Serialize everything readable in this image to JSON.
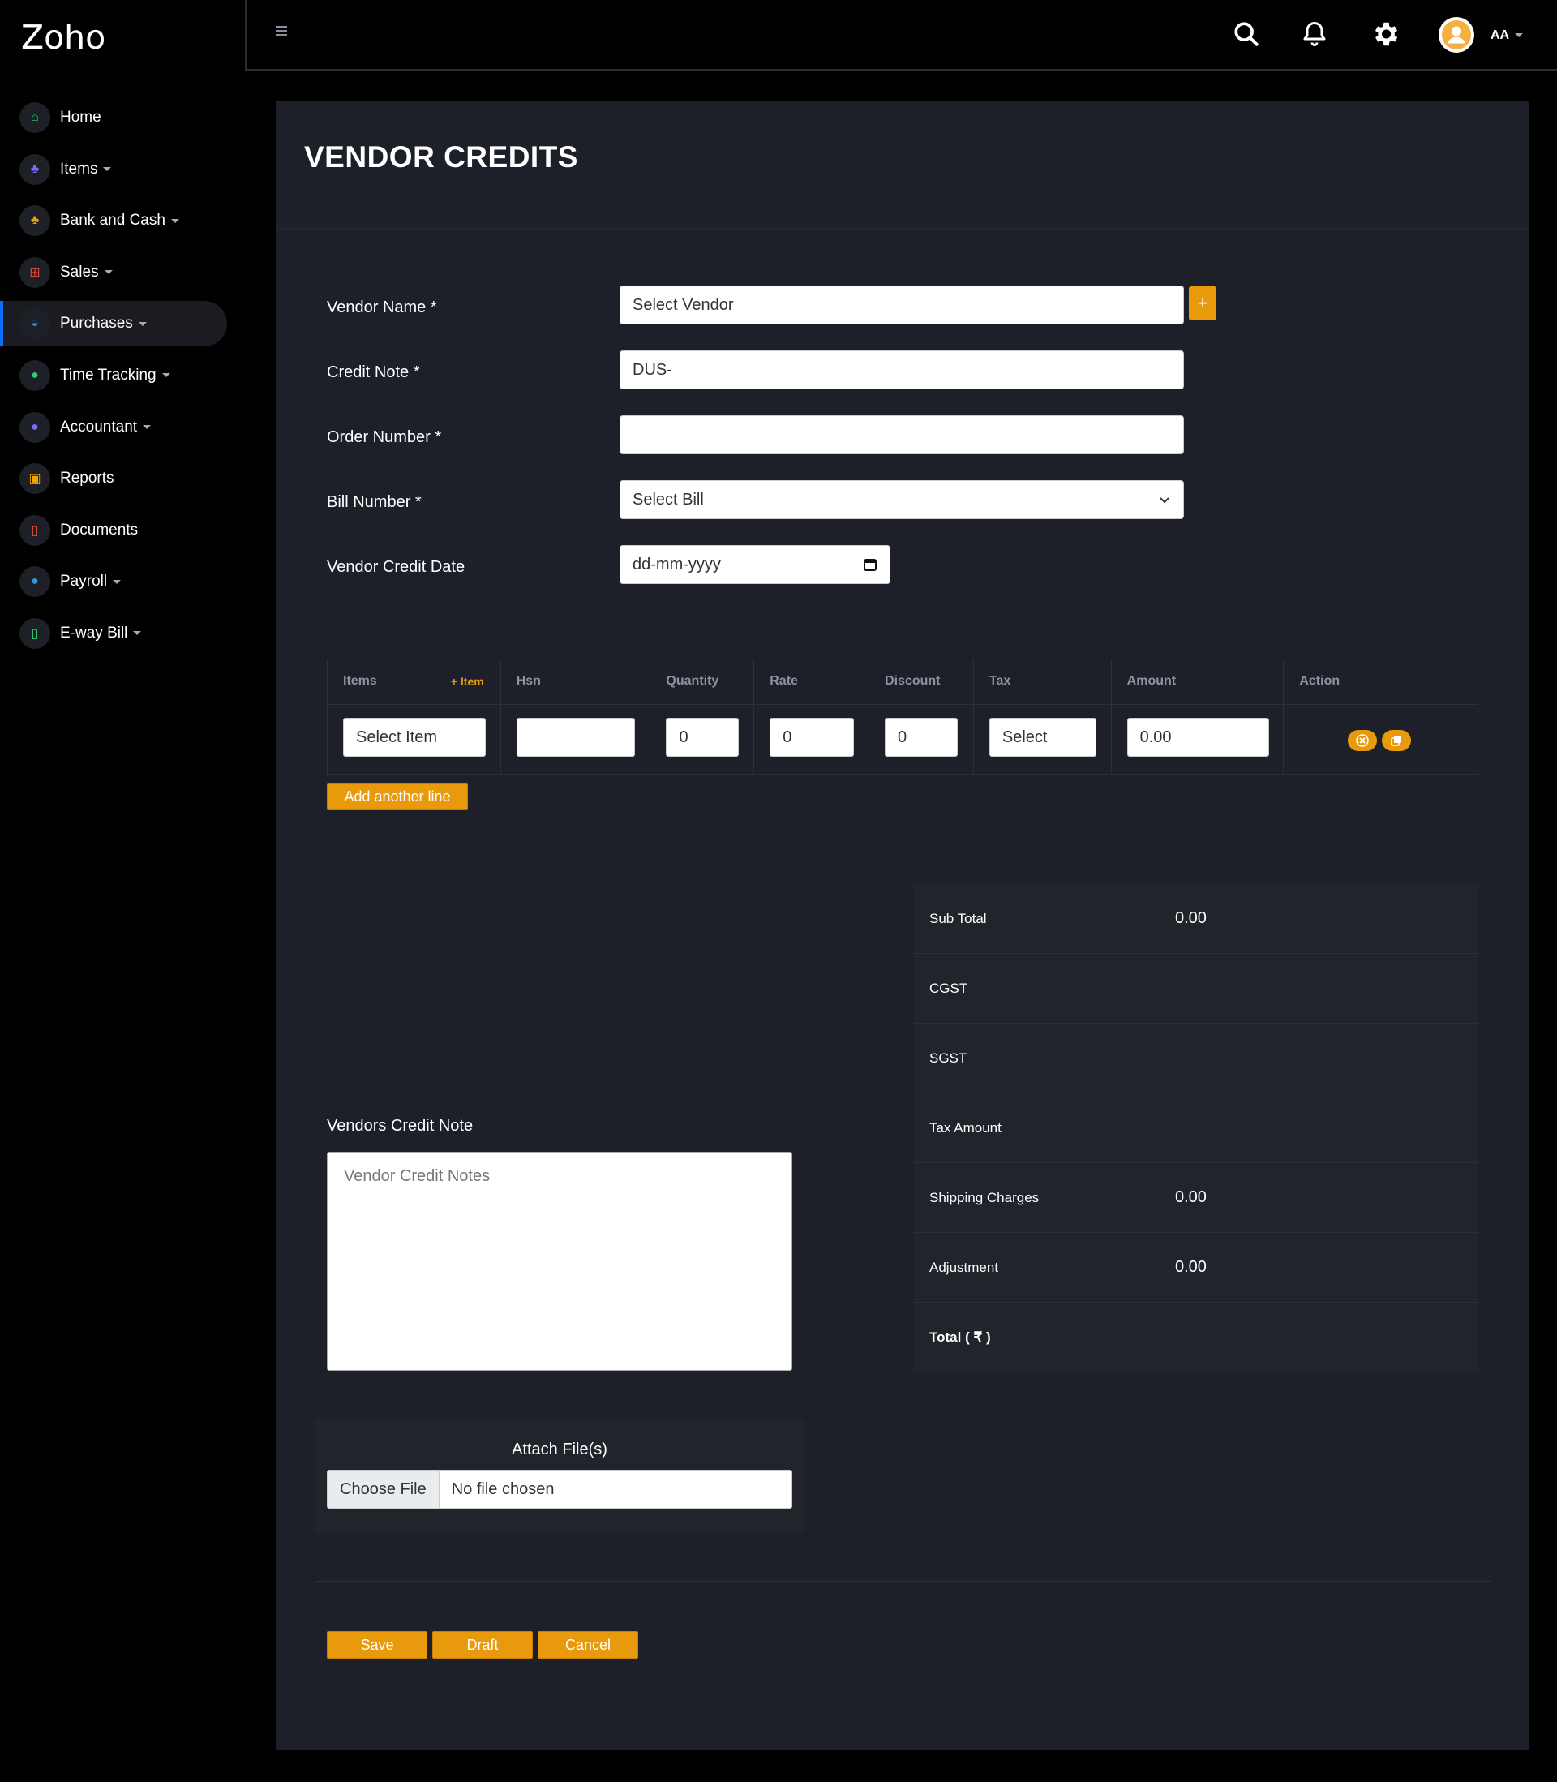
{
  "app": {
    "brand": "Zoho"
  },
  "sidebar": {
    "items": [
      {
        "label": "Home",
        "icon": "home-icon",
        "glyph": "⌂",
        "color": "#2ecc71",
        "caret": false
      },
      {
        "label": "Items",
        "icon": "sitemap-icon",
        "glyph": "♣",
        "color": "#7b6cf6",
        "caret": true
      },
      {
        "label": "Bank and Cash",
        "icon": "sitemap-icon",
        "glyph": "♣",
        "color": "#f0a500",
        "caret": true
      },
      {
        "label": "Sales",
        "icon": "cart-icon",
        "glyph": "⊞",
        "color": "#e74c3c",
        "caret": true
      },
      {
        "label": "Purchases",
        "icon": "basket-icon",
        "glyph": "◒",
        "color": "#3498db",
        "caret": true
      },
      {
        "label": "Time Tracking",
        "icon": "clock-icon",
        "glyph": "●",
        "color": "#2ecc71",
        "caret": true
      },
      {
        "label": "Accountant",
        "icon": "user-icon",
        "glyph": "●",
        "color": "#7b6cf6",
        "caret": true
      },
      {
        "label": "Reports",
        "icon": "calendar-icon",
        "glyph": "▣",
        "color": "#f0a500",
        "caret": false
      },
      {
        "label": "Documents",
        "icon": "document-icon",
        "glyph": "▯",
        "color": "#e74c3c",
        "caret": false
      },
      {
        "label": "Payroll",
        "icon": "user-icon",
        "glyph": "●",
        "color": "#3498db",
        "caret": true
      },
      {
        "label": "E-way Bill",
        "icon": "document-icon",
        "glyph": "▯",
        "color": "#2ecc71",
        "caret": true
      }
    ],
    "active_index": 4
  },
  "topbar": {
    "user_initials": "AA"
  },
  "page": {
    "title": "VENDOR CREDITS"
  },
  "form": {
    "vendor_name": {
      "label": "Vendor Name *",
      "value": "Select Vendor"
    },
    "credit_note": {
      "label": "Credit Note *",
      "value": "DUS-"
    },
    "order_number": {
      "label": "Order Number *",
      "value": ""
    },
    "bill_number": {
      "label": "Bill Number *",
      "value": "Select Bill"
    },
    "credit_date": {
      "label": "Vendor Credit Date",
      "value": "dd-mm-yyyy"
    },
    "add_vendor": "+"
  },
  "items_table": {
    "headers": [
      "Items",
      "Hsn",
      "Quantity",
      "Rate",
      "Discount",
      "Tax",
      "Amount",
      "Action"
    ],
    "add_item": "+ Item",
    "row": {
      "item": "Select Item",
      "hsn": "",
      "quantity": "0",
      "rate": "0",
      "discount": "0",
      "tax": "Select",
      "amount": "0.00"
    },
    "add_line": "Add another line"
  },
  "totals": [
    {
      "label": "Sub Total",
      "value": "0.00",
      "bold": false
    },
    {
      "label": "CGST",
      "value": "",
      "bold": false
    },
    {
      "label": "SGST",
      "value": "",
      "bold": false
    },
    {
      "label": "Tax Amount",
      "value": "",
      "bold": false
    },
    {
      "label": "Shipping Charges",
      "value": "0.00",
      "bold": false
    },
    {
      "label": "Adjustment",
      "value": "0.00",
      "bold": false
    },
    {
      "label": "Total ( ₹ )",
      "value": "",
      "bold": true
    }
  ],
  "notes": {
    "label": "Vendors Credit Note",
    "placeholder": "Vendor Credit Notes"
  },
  "attach": {
    "title": "Attach File(s)",
    "button": "Choose File",
    "status": "No file chosen"
  },
  "actions": {
    "save": "Save",
    "draft": "Draft",
    "cancel": "Cancel"
  },
  "colors": {
    "accent": "#e89a0c",
    "panel": "#1d2028",
    "active_indicator": "#0d6efd"
  }
}
